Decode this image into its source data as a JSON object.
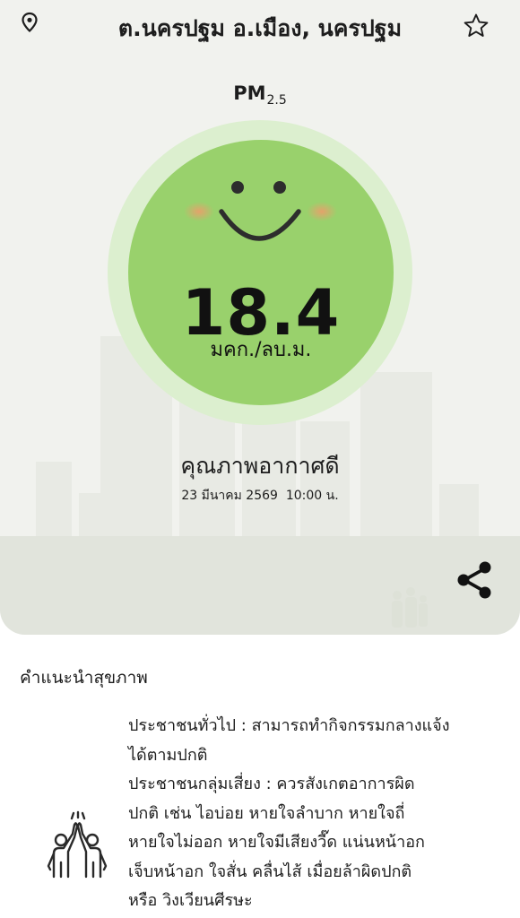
{
  "header": {
    "location": "ต.นครปฐม อ.เมือง, นครปฐม",
    "pin_icon": "location-pin-icon",
    "favorite_icon": "star-outline-icon"
  },
  "pm": {
    "label": "PM",
    "subscript": "2.5",
    "value": "18.4",
    "unit": "มคก./ลบ.ม.",
    "face_icon": "smiley-face-icon",
    "colors": {
      "ring": "#dcefcf",
      "fill": "#99d16c",
      "cheeks": "#e8a06b"
    }
  },
  "status": {
    "quality": "คุณภาพอากาศดี",
    "timestamp": "23 มีนาคม 2569  10:00 น."
  },
  "share_icon": "share-icon",
  "advice": {
    "title": "คำแนะนำสุขภาพ",
    "icon": "people-high-five-icon",
    "lines": [
      "ประชาชนทั่วไป : สามารถทำกิจกรรมกลางแจ้ง",
      "ได้ตามปกติ",
      "ประชาชนกลุ่มเสี่ยง : ควรสังเกตอาการผิด",
      "ปกติ เช่น ไอบ่อย หายใจลำบาก หายใจถี่",
      "หายใจไม่ออก หายใจมีเสียงวี๊ด แน่นหน้าอก",
      "เจ็บหน้าอก ใจสั่น คลื่นไส้ เมื่อยล้าผิดปกติ",
      "หรือ วิงเวียนศีรษะ"
    ]
  }
}
